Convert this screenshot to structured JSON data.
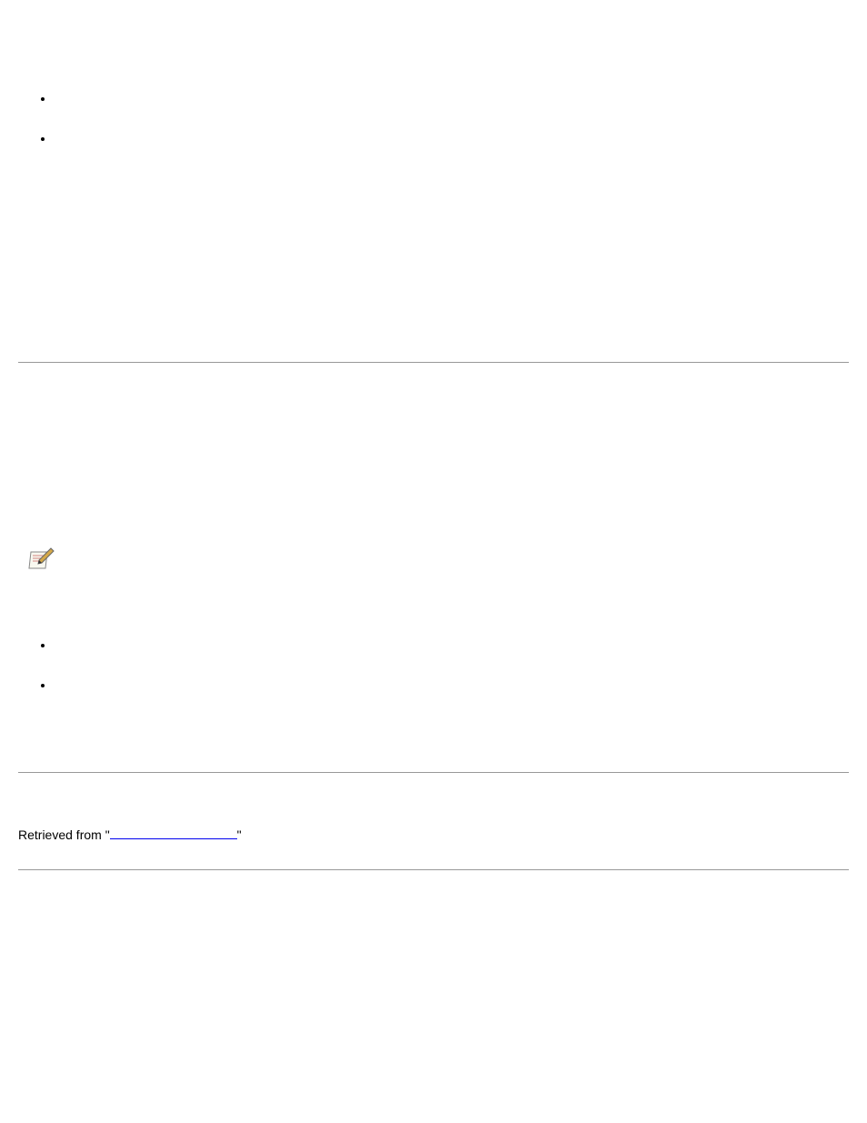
{
  "list1": {
    "items": [
      "",
      ""
    ]
  },
  "note": {
    "icon_name": "note-pencil-icon"
  },
  "list2": {
    "items": [
      "",
      ""
    ]
  },
  "retrieved": {
    "prefix": "Retrieved from \"",
    "link_text": "",
    "link_url": "#",
    "suffix": "\""
  }
}
